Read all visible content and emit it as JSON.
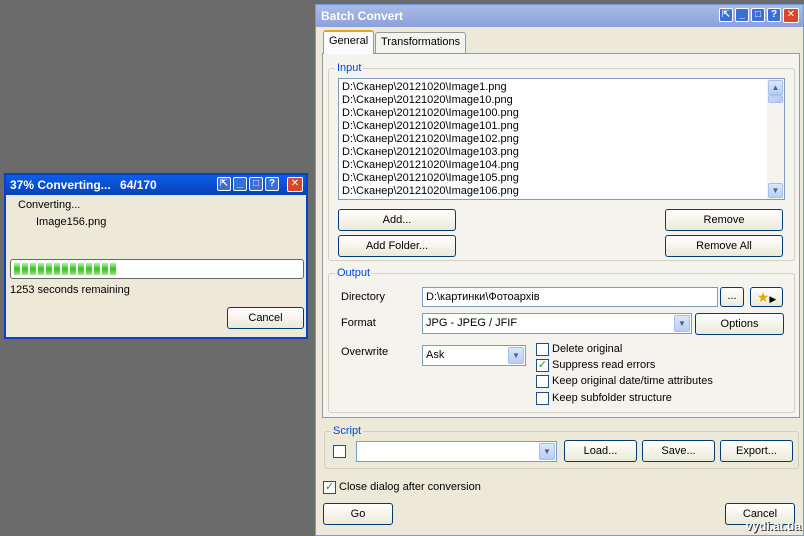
{
  "batch": {
    "title": "Batch Convert",
    "tabs": [
      "General",
      "Transformations"
    ],
    "input": {
      "legend": "Input",
      "files": [
        "D:\\Сканер\\20121020\\Image1.png",
        "D:\\Сканер\\20121020\\Image10.png",
        "D:\\Сканер\\20121020\\Image100.png",
        "D:\\Сканер\\20121020\\Image101.png",
        "D:\\Сканер\\20121020\\Image102.png",
        "D:\\Сканер\\20121020\\Image103.png",
        "D:\\Сканер\\20121020\\Image104.png",
        "D:\\Сканер\\20121020\\Image105.png",
        "D:\\Сканер\\20121020\\Image106.png"
      ],
      "add_label": "Add...",
      "add_folder_label": "Add Folder...",
      "remove_label": "Remove",
      "remove_all_label": "Remove All"
    },
    "output": {
      "legend": "Output",
      "directory_label": "Directory",
      "directory_value": "D:\\картинки\\Фотоархів",
      "browse_label": "...",
      "format_label": "Format",
      "format_value": "JPG - JPEG / JFIF",
      "options_label": "Options",
      "overwrite_label": "Overwrite",
      "overwrite_value": "Ask",
      "delete_original": "Delete original",
      "suppress_errors": "Suppress read errors",
      "keep_datetime": "Keep original date/time attributes",
      "keep_subfolder": "Keep subfolder structure"
    },
    "script": {
      "legend": "Script",
      "load_label": "Load...",
      "save_label": "Save...",
      "export_label": "Export..."
    },
    "close_after": "Close dialog after conversion",
    "go_label": "Go",
    "cancel_label": "Cancel"
  },
  "progress": {
    "title": "37% Converting...",
    "count": "64/170",
    "status": "Converting...",
    "file": "Image156.png",
    "remaining": "1253 seconds remaining",
    "cancel_label": "Cancel"
  },
  "watermark": "vydi.at.ua"
}
